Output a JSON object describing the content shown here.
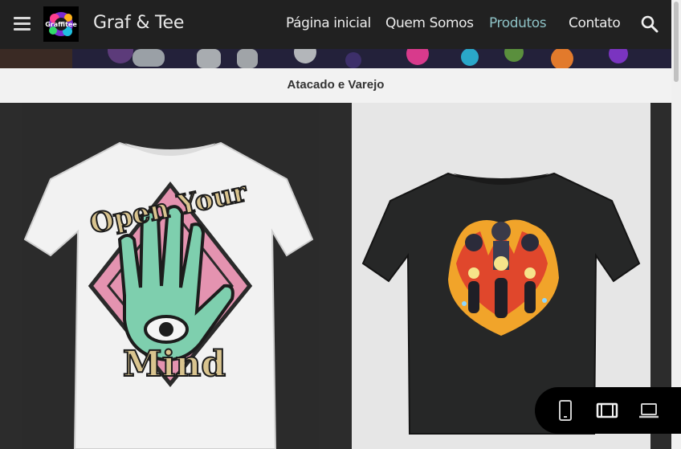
{
  "header": {
    "brand": "Graf & Tee",
    "logo_text": "Graffitee",
    "nav": [
      {
        "label": "Página inicial"
      },
      {
        "label": "Quem Somos"
      },
      {
        "label": "Produtos"
      },
      {
        "label": "Contato"
      }
    ],
    "active_color": "#8ec2c6"
  },
  "category": {
    "label": "Atacado e Varejo"
  },
  "products": [
    {
      "print_text_top": "Open Your",
      "print_text_bottom": "Mind",
      "shirt_color": "white"
    },
    {
      "shirt_color": "black",
      "print": "motorcyclists"
    }
  ],
  "icons": [
    "menu-icon",
    "search-icon",
    "phone-view-icon",
    "tablet-view-icon",
    "laptop-view-icon"
  ]
}
